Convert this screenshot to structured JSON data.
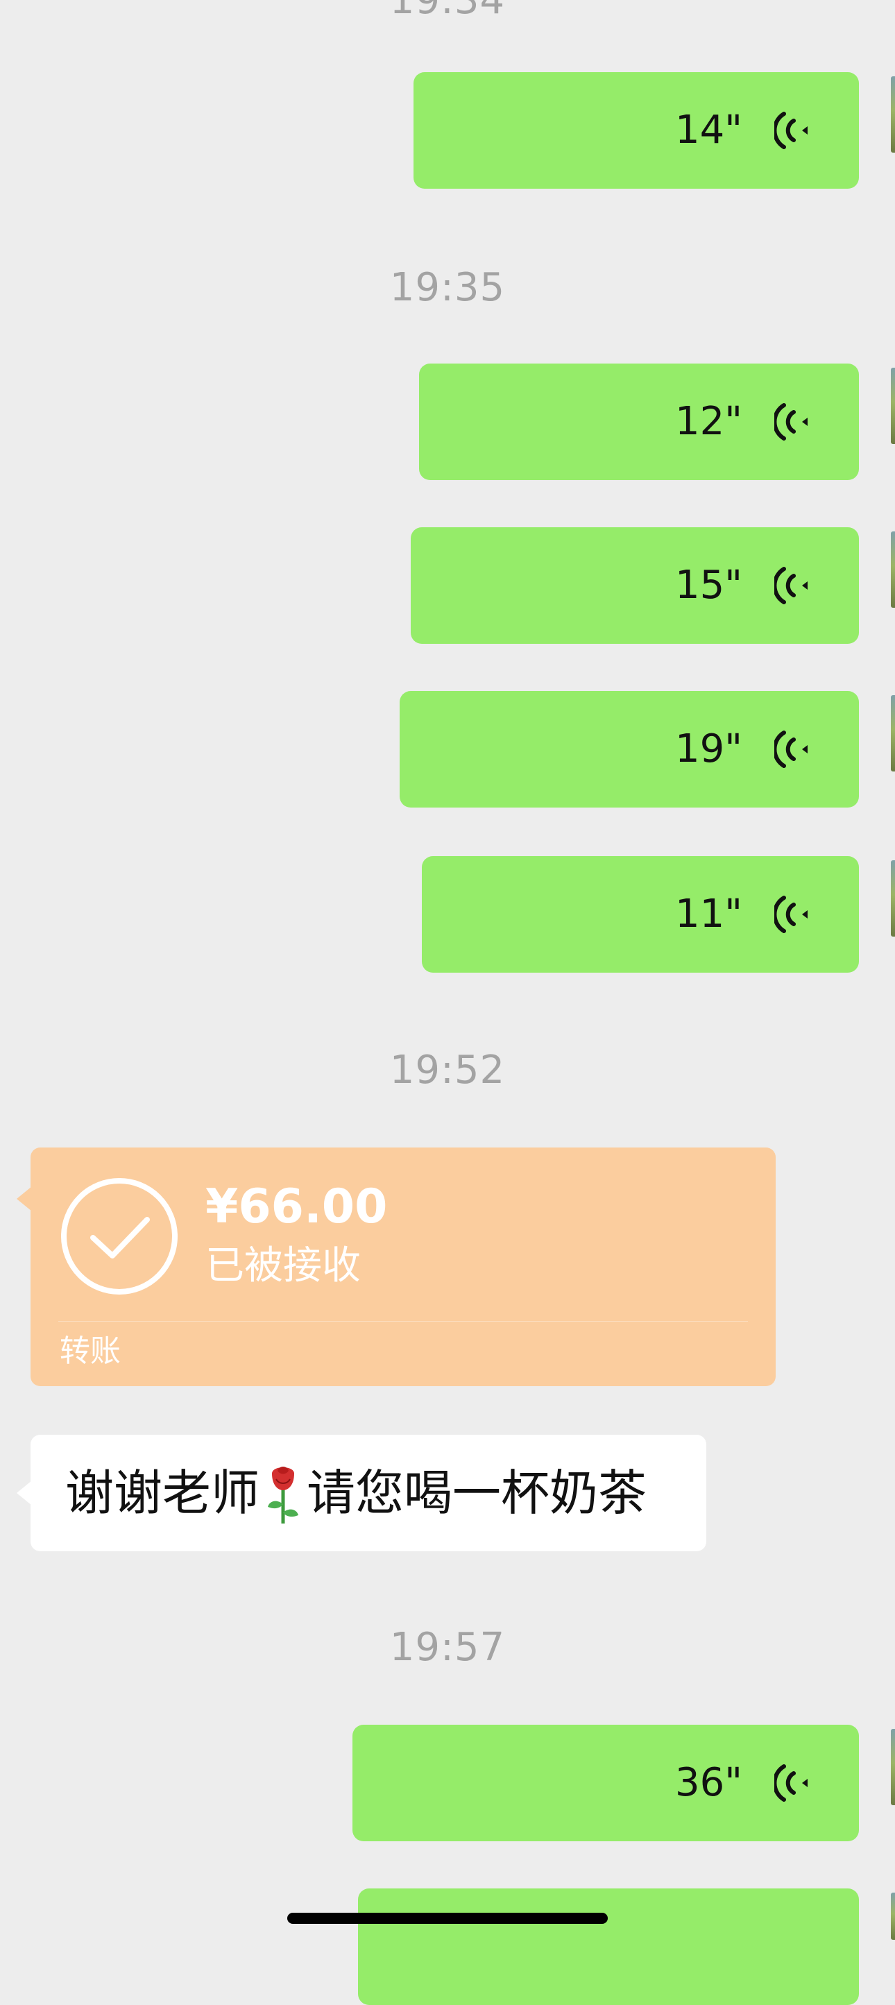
{
  "chat": {
    "timestamps": [
      "19:34",
      "19:35",
      "19:52",
      "19:57"
    ],
    "voice_messages": [
      {
        "duration": "14\""
      },
      {
        "duration": "12\""
      },
      {
        "duration": "15\""
      },
      {
        "duration": "19\""
      },
      {
        "duration": "11\""
      },
      {
        "duration": "36\""
      },
      {
        "duration": "⁠"
      }
    ],
    "transfer": {
      "amount": "¥66.00",
      "status": "已被接收",
      "label": "转账"
    },
    "text_message": {
      "before_emoji": "谢谢老师",
      "emoji": "rose",
      "after_emoji": "请您喝一杯奶茶"
    }
  },
  "colors": {
    "background": "#ededed",
    "outgoing_bubble": "#95ec69",
    "transfer_bubble": "#fbcd9e",
    "incoming_bubble": "#ffffff",
    "timestamp_text": "#a3a3a3"
  },
  "icons": [
    "voice-wave-icon",
    "check-circle-icon",
    "rose-emoji"
  ]
}
